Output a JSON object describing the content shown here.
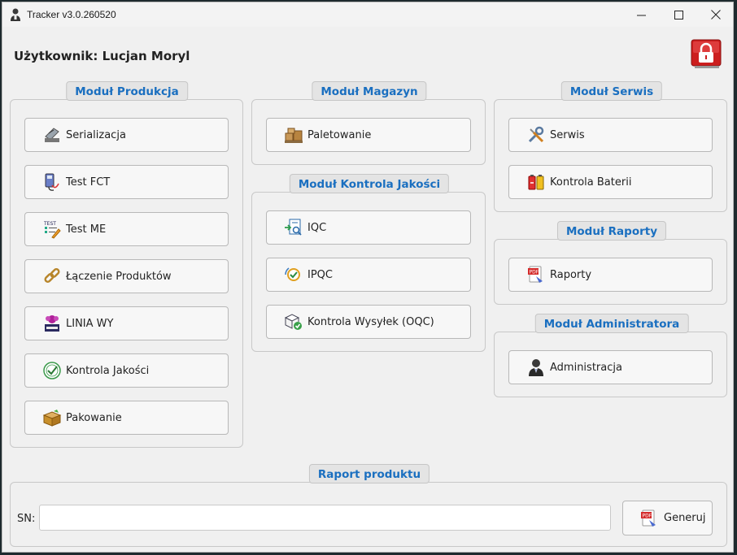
{
  "window": {
    "title": "Tracker v3.0.260520"
  },
  "header": {
    "user_label": "Użytkownik: Lucjan Moryl"
  },
  "modules": {
    "produkcja": {
      "title": "Moduł Produkcja",
      "items": [
        "Serializacja",
        "Test FCT",
        "Test ME",
        "Łączenie Produktów",
        "LINIA WY",
        "Kontrola Jakości",
        "Pakowanie"
      ]
    },
    "magazyn": {
      "title": "Moduł Magazyn",
      "items": [
        "Paletowanie"
      ]
    },
    "kontrola": {
      "title": "Moduł Kontrola Jakości",
      "items": [
        "IQC",
        "IPQC",
        "Kontrola Wysyłek (OQC)"
      ]
    },
    "serwis": {
      "title": "Moduł Serwis",
      "items": [
        "Serwis",
        "Kontrola Baterii"
      ]
    },
    "raporty": {
      "title": "Moduł Raporty",
      "items": [
        "Raporty"
      ]
    },
    "admin": {
      "title": "Moduł Administratora",
      "items": [
        "Administracja"
      ]
    }
  },
  "report": {
    "title": "Raport produktu",
    "sn_label": "SN:",
    "sn_value": "",
    "generate_label": "Generuj"
  },
  "colors": {
    "accent": "#1a6fc0",
    "window_bg": "#f0f0f0",
    "lock_red": "#d42020"
  }
}
